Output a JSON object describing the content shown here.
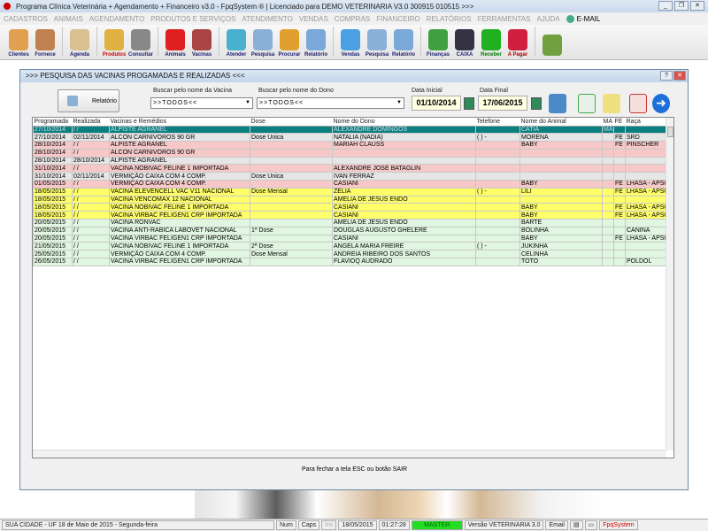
{
  "window": {
    "title": "Programa Clínica Veterinária + Agendamento + Financeiro v3.0 - FpqSystem ® | Licenciado para  DEMO VETERINARIA V3.0 300915 010515 >>>"
  },
  "menu": [
    "CADASTROS",
    "ANIMAIS",
    "AGENDAMENTO",
    "PRODUTOS E SERVIÇOS",
    "ATENDIMENTO",
    "VENDAS",
    "COMPRAS",
    "FINANCEIRO",
    "RELATÓRIOS",
    "FERRAMENTAS",
    "AJUDA"
  ],
  "menu_email": "E-MAIL",
  "toolbar": [
    {
      "label": "Clientes",
      "color": "#e0a050"
    },
    {
      "label": "Fornece",
      "color": "#c08050"
    },
    "sep",
    {
      "label": "Agenda",
      "color": "#d8c090"
    },
    "sep",
    {
      "label": "Produtos",
      "color": "#e0b040",
      "text": "#c00"
    },
    {
      "label": "Consultar",
      "color": "#888"
    },
    "sep",
    {
      "label": "Animais",
      "color": "#e02020"
    },
    {
      "label": "Vacinas",
      "color": "#aa4444"
    },
    "sep",
    {
      "label": "Atender",
      "color": "#4ab0d0"
    },
    {
      "label": "Pesquisa",
      "color": "#8ab0d8"
    },
    {
      "label": "Procurar",
      "color": "#e0a030"
    },
    {
      "label": "Relatório",
      "color": "#7aa8d8"
    },
    "sep",
    {
      "label": "Vendas",
      "color": "#4aa0e0"
    },
    {
      "label": "Pesquisa",
      "color": "#8ab0d8"
    },
    {
      "label": "Relatório",
      "color": "#7aa8d8"
    },
    "sep",
    {
      "label": "Finanças",
      "color": "#40a040"
    },
    {
      "label": "CAIXA",
      "color": "#334"
    },
    {
      "label": "Receber",
      "color": "#20b020",
      "text": "#070"
    },
    {
      "label": "A Pagar",
      "color": "#d02040",
      "text": "#a00"
    },
    "sep",
    {
      "label": "",
      "color": "#70a040"
    }
  ],
  "dialog": {
    "title": ">>>  PESQUISA DAS VACINAS PROGAMADAS E REALIZADAS  <<<",
    "report_button": "Relatório",
    "vaccine_label": "Buscar pelo nome da Vacina",
    "vaccine_value": ">>TODOS<<",
    "owner_label": "Buscar pelo nome do Dono",
    "owner_value": ">>TODOS<<",
    "start_label": "Data Inicial",
    "start_value": "01/10/2014",
    "end_label": "Data Final",
    "end_value": "17/06/2015",
    "hint": "Para fechar a tela ESC ou botão SAIR"
  },
  "grid": {
    "columns": [
      "Programada",
      "Realizada",
      "Vacinas e Remédios",
      "Dose",
      "Nome do Dono",
      "Telefone",
      "Nome do Animal",
      "MA",
      "FE",
      "Raça"
    ],
    "rows": [
      {
        "s": "sel",
        "c": [
          "27/10/2014",
          " / /",
          "ALPISTE AGRANEL",
          "",
          "ALEXANDRE DOMINGOS",
          "",
          "CATIA",
          "MA",
          "",
          ""
        ]
      },
      {
        "s": "gray",
        "c": [
          "27/10/2014",
          "02/11/2014",
          "ALCON CARNIVOROS 90 GR",
          "Dose Unica",
          "NATALIA (NADIA)",
          "( )   -",
          "MORENA",
          "",
          "FE",
          "SRD"
        ]
      },
      {
        "s": "pink",
        "c": [
          "28/10/2014",
          " / /",
          " ALPISTE AGRANEL",
          "",
          "MARIAH CLAUSS",
          "",
          "BABY",
          "",
          "FE",
          "PINSCHER"
        ]
      },
      {
        "s": "pink",
        "c": [
          "28/10/2014",
          " / /",
          "ALCON CARNIVOROS 90 GR",
          "",
          "",
          "",
          "",
          "",
          "",
          ""
        ]
      },
      {
        "s": "gray",
        "c": [
          "28/10/2014",
          "28/10/2014",
          "ALPISTE AGRANEL",
          "",
          "",
          "",
          "",
          "",
          "",
          ""
        ]
      },
      {
        "s": "pink",
        "c": [
          "31/10/2014",
          " / /",
          "VACINA NOBIVAC FELINE 1 IMPORTADA",
          "",
          "ALEXANDRE JOSE BATAGLIN",
          "",
          "",
          "",
          "",
          ""
        ]
      },
      {
        "s": "gray",
        "c": [
          "31/10/2014",
          "02/11/2014",
          "VERMIÇÃO CAIXA COM 4 COMP.",
          "Dose Unica",
          "IVAN FERRAZ",
          "",
          "",
          "",
          "",
          ""
        ]
      },
      {
        "s": "pink",
        "c": [
          "01/05/2015",
          " / /",
          "VERMIÇÃO CAIXA COM 4 COMP.",
          "",
          "CASIANI",
          "",
          "BABY",
          "",
          "FE",
          "LHASA - APSO"
        ]
      },
      {
        "s": "yellow",
        "c": [
          "18/05/2015",
          " / /",
          "VACINA ELEVENCELL VAC V11 NACIONAL",
          "Dose Mensal",
          "ZELIA",
          "( )   -",
          "LILI",
          "",
          "FE",
          "LHASA - APSO"
        ]
      },
      {
        "s": "yellow",
        "c": [
          "18/05/2015",
          " / /",
          "VACINA VENCOMAX 12 NACIONAL",
          "",
          "AMELIA DE JESUS ENDO",
          "",
          "",
          "",
          "",
          ""
        ]
      },
      {
        "s": "yellow",
        "c": [
          "18/05/2015",
          " / /",
          "VACINA NOBIVAC FELINE 1 IMPORTADA",
          "",
          "CASIANI",
          "",
          "BABY",
          "",
          "FE",
          "LHASA - APSO"
        ]
      },
      {
        "s": "yellow",
        "c": [
          "18/05/2015",
          " / /",
          "VACINA VIRBAC FELIGEN1 CRP IMPORTADA",
          "",
          "CASIANI",
          "",
          "BABY",
          "",
          "FE",
          "LHASA - APSO"
        ]
      },
      {
        "s": "green",
        "c": [
          "20/05/2015",
          " / /",
          "VACINA RONVAC",
          "",
          "AMELIA DE JESUS ENDO",
          "",
          "BARTE",
          "",
          "",
          ""
        ]
      },
      {
        "s": "green",
        "c": [
          "20/05/2015",
          " / /",
          "VACINA ANTI-RABICA LABOVET NACIONAL",
          "1ª Dose",
          "DOUGLAS AUGUSTO GHELERE",
          "",
          "BOLINHA",
          "",
          "",
          "CANINA"
        ]
      },
      {
        "s": "green",
        "c": [
          "20/05/2015",
          " / /",
          "VACINA VIRBAC FELIGEN1 CRP IMPORTADA",
          "",
          "CASIANI",
          "",
          "BABY",
          "",
          "FE",
          "LHASA - APSO"
        ]
      },
      {
        "s": "green",
        "c": [
          "21/05/2015",
          " / /",
          "VACINA NOBIVAC FELINE 1 IMPORTADA",
          "2ª Dose",
          "ANGELA MARIA FREIRE",
          "( )   -",
          "JUKINHA",
          "",
          "",
          ""
        ]
      },
      {
        "s": "green",
        "c": [
          "25/05/2015",
          " / /",
          "VERMIÇÃO CAIXA COM 4 COMP.",
          "Dose Mensal",
          "ANDREIA RIBEIRO DOS SANTOS",
          "",
          "CELINHA",
          "",
          "",
          ""
        ]
      },
      {
        "s": "green",
        "c": [
          "26/05/2015",
          " / /",
          "VACINA VIRBAC FELIGEN1 CRP IMPORTADA",
          "",
          "FLAVIOQ AUDRADO",
          "",
          "TOTO",
          "",
          "",
          "POLDOL"
        ]
      }
    ]
  },
  "status": {
    "city": "SUA CIDADE - UF 18 de Maio de 2015 - Segunda-feira",
    "num": "Num",
    "caps": "Caps",
    "ins": "Ins",
    "date": "18/05/2015",
    "time": "01:27:28",
    "user": "MASTER",
    "version": "Versão VETERINARIA 3.0",
    "email": "Email",
    "brand": "FpqSystem"
  }
}
